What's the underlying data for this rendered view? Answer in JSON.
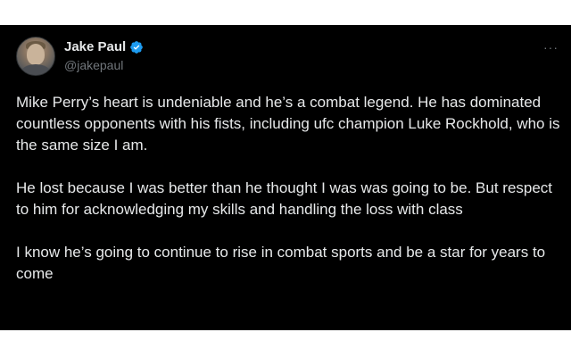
{
  "tweet": {
    "author_name": "Jake Paul",
    "author_handle": "@jakepaul",
    "verified": true,
    "accent_color": "#1d9bf0",
    "more_icon": "more-dots-icon",
    "paragraphs": [
      "Mike Perry’s heart is undeniable and he’s a combat legend. He has dominated countless opponents with his fists, including ufc champion Luke Rockhold, who is the same size I am.",
      "He lost because I was better than he thought I was was going to be. But respect to him for acknowledging my skills and handling the loss with class",
      "I know he’s going to continue to rise in combat sports and be a star for years to come"
    ]
  }
}
